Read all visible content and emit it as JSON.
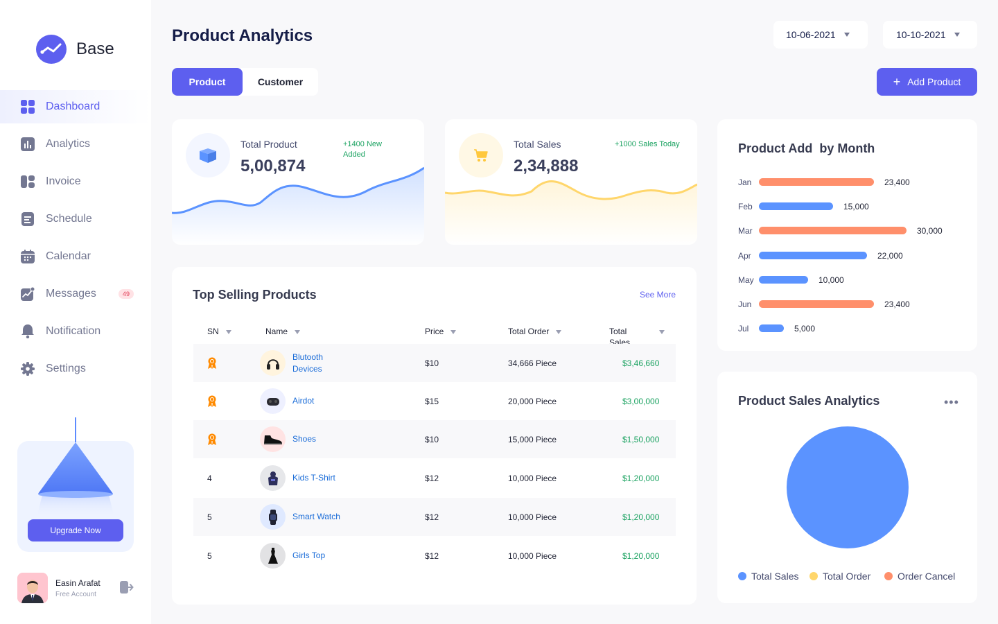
{
  "brand": {
    "name": "Base"
  },
  "sidebar": {
    "items": [
      {
        "label": "Dashboard",
        "icon": "dashboard-icon",
        "active": true
      },
      {
        "label": "Analytics",
        "icon": "analytics-icon"
      },
      {
        "label": "Invoice",
        "icon": "invoice-icon"
      },
      {
        "label": "Schedule",
        "icon": "schedule-icon"
      },
      {
        "label": "Calendar",
        "icon": "calendar-icon"
      },
      {
        "label": "Messages",
        "icon": "messages-icon",
        "badge": "49"
      },
      {
        "label": "Notification",
        "icon": "bell-icon"
      },
      {
        "label": "Settings",
        "icon": "gear-icon"
      }
    ],
    "upgrade_label": "Upgrade Now"
  },
  "user": {
    "name": "Easin Arafat",
    "account": "Free Account"
  },
  "header": {
    "title": "Product Analytics",
    "date_from": "10-06-2021",
    "date_to": "10-10-2021",
    "tabs": [
      "Product",
      "Customer"
    ],
    "add_label": "Add Product"
  },
  "stats": [
    {
      "label": "Total Product",
      "value": "5,00,874",
      "note": "+1400 New Added",
      "note_line1": "+1400 New",
      "note_line2": "Added"
    },
    {
      "label": "Total Sales",
      "value": "2,34,888",
      "note": "+1000 Sales Today"
    }
  ],
  "top_selling": {
    "title": "Top Selling Products",
    "see_more": "See More",
    "columns": [
      "SN",
      "Name",
      "Price",
      "Total Order",
      "Total Sales"
    ],
    "total_sales_line1": "Total",
    "total_sales_line2": "Sales",
    "rows": [
      {
        "sn": "",
        "rank_icon": "medal-icon",
        "name": "Blutooth Devices",
        "name_line1": "Blutooth",
        "name_line2": "Devices",
        "price": "$10",
        "order": "34,666 Piece",
        "sales": "$3,46,660"
      },
      {
        "sn": "",
        "rank_icon": "medal-icon",
        "name": "Airdot",
        "price": "$15",
        "order": "20,000 Piece",
        "sales": "$3,00,000"
      },
      {
        "sn": "",
        "rank_icon": "medal-icon",
        "name": "Shoes",
        "price": "$10",
        "order": "15,000 Piece",
        "sales": "$1,50,000"
      },
      {
        "sn": "4",
        "name": "Kids T-Shirt",
        "price": "$12",
        "order": "10,000 Piece",
        "sales": "$1,20,000"
      },
      {
        "sn": "5",
        "name": "Smart Watch",
        "price": "$12",
        "order": "10,000 Piece",
        "sales": "$1,20,000"
      },
      {
        "sn": "5",
        "name": "Girls Top",
        "price": "$12",
        "order": "10,000 Piece",
        "sales": "$1,20,000"
      }
    ]
  },
  "month_card": {
    "title": "Product Add  by Month"
  },
  "pie_card": {
    "title": "Product Sales Analytics",
    "legend": [
      "Total Sales",
      "Total Order",
      "Order Cancel"
    ]
  },
  "colors": {
    "accent": "#5d5fef",
    "blue": "#5b93ff",
    "orange": "#ff8f6b",
    "yellow": "#ffd66b",
    "green": "#1aa260"
  },
  "chart_data": [
    {
      "type": "bar",
      "title": "Product Add  by Month",
      "orientation": "horizontal",
      "categories": [
        "Jan",
        "Feb",
        "Mar",
        "Apr",
        "May",
        "Jun",
        "Jul"
      ],
      "values": [
        23400,
        15000,
        30000,
        22000,
        10000,
        23400,
        5000
      ],
      "value_labels": [
        "23,400",
        "15,000",
        "30,000",
        "22,000",
        "10,000",
        "23,400",
        "5,000"
      ],
      "bar_colors": [
        "#ff8f6b",
        "#5b93ff",
        "#ff8f6b",
        "#5b93ff",
        "#5b93ff",
        "#ff8f6b",
        "#5b93ff"
      ]
    },
    {
      "type": "pie",
      "title": "Product Sales Analytics",
      "labels": [
        "Total Sales",
        "Total Order",
        "Order Cancel"
      ],
      "values": [
        100,
        0,
        0
      ],
      "colors": [
        "#5b93ff",
        "#ffd66b",
        "#ff8f6b"
      ]
    }
  ]
}
